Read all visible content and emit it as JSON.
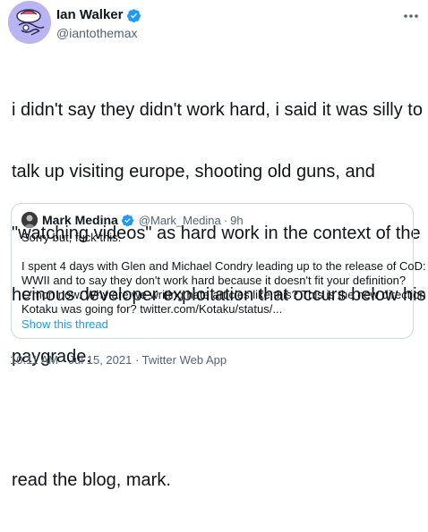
{
  "author": {
    "name": "Ian Walker",
    "handle": "@iantothemax",
    "verified": true
  },
  "tweet_lines": [
    "i didn't say they didn't work hard, i said it was silly to",
    "talk up visiting europe, shooting old guns, and",
    "\"watching videos\" as hard work in the context of the",
    "heinous developer exploitation that occurs below his",
    "paygrade."
  ],
  "tweet_line2": "read the blog, mark.",
  "quoted": {
    "name": "Mark Medina",
    "handle": "@Mark_Medina",
    "separator": "·",
    "time": "9h",
    "line1": "Sorry but, fuck this.",
    "body_lines": [
      "I spent 4 days with Glen and Michael Condry leading up to the release of CoD:",
      "WWII and to say they don't work hard because it doesn't fit your definition?",
      "C'mon now. Why are we writing hate articles like this? This is the new direction",
      "Kotaku was going for? twitter.com/Kotaku/status/..."
    ],
    "show_thread": "Show this thread"
  },
  "meta": {
    "time_date": "10:11 AM · Jul 15, 2021 · ",
    "app": "Twitter Web App"
  },
  "colors": {
    "verified": "#1d9bf0",
    "link": "#1d9bf0",
    "avatar_bg": "#b9b4f2"
  },
  "icons": {
    "more": "more-icon",
    "verified": "verified-badge-icon"
  }
}
